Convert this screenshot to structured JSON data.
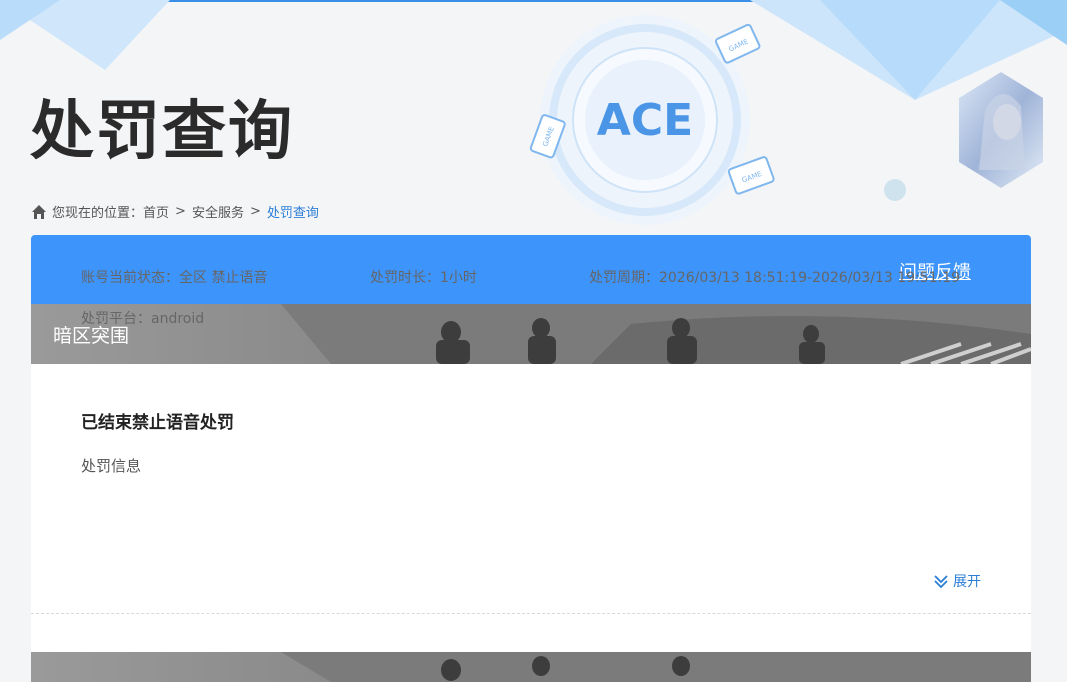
{
  "page": {
    "title": "处罚查询"
  },
  "breadcrumb": {
    "prefix": "您现在的位置：",
    "items": [
      "首页",
      "安全服务"
    ],
    "separator": ">",
    "current": "处罚查询"
  },
  "banner_art": {
    "logo_text": "ACE",
    "badges": [
      "GAME",
      "GAME",
      "GAME"
    ]
  },
  "panel": {
    "feedback_label": "问题反馈",
    "game_name": "暗区突围",
    "record": {
      "title": "已结束禁止语音处罚",
      "section_label": "处罚信息",
      "status": "账号当前状态：全区 禁止语音",
      "duration": "处罚时长：1小时",
      "period": "处罚周期：2026/03/13 18:51:19-2026/03/13 19:51:19",
      "platform": "处罚平台：android",
      "expand_label": "展开"
    }
  },
  "colors": {
    "accent": "#3d94fb",
    "link": "#2a7ed6",
    "title": "#2b2b2b",
    "background": "#f4f5f7"
  },
  "icons": {
    "home": "home-icon",
    "expand": "double-chevron-down-icon"
  }
}
